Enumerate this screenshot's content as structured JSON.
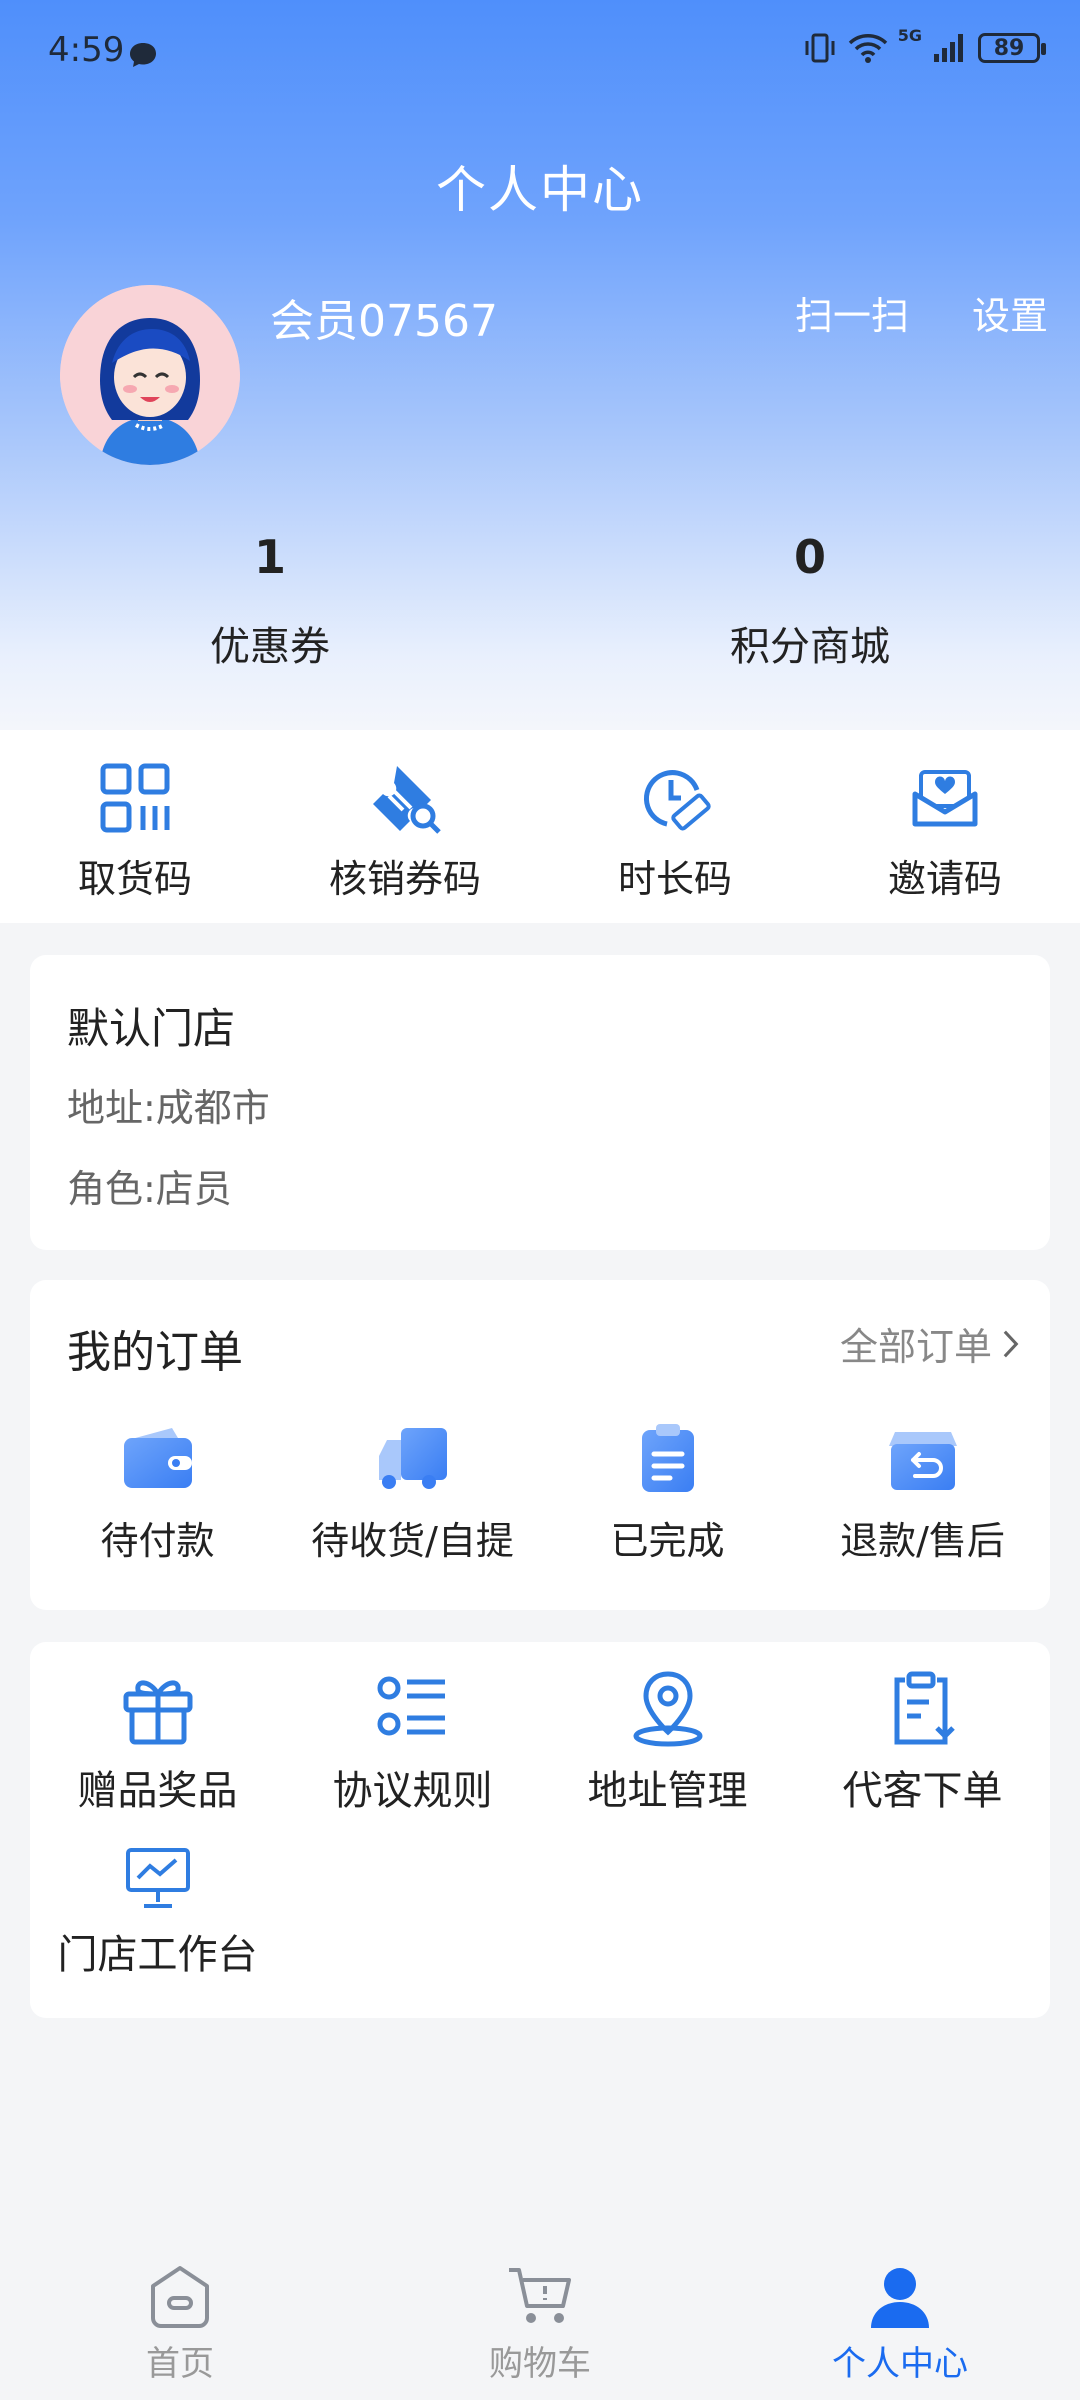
{
  "status_bar": {
    "time": "4:59",
    "network": "5G",
    "battery": "89"
  },
  "header": {
    "title": "个人中心",
    "username": "会员07567",
    "scan_label": "扫一扫",
    "settings_label": "设置"
  },
  "stats": {
    "coupon_count": "1",
    "coupon_label": "优惠券",
    "points_count": "0",
    "points_label": "积分商城"
  },
  "tools": [
    {
      "label": "取货码",
      "icon": "qr-grid-icon"
    },
    {
      "label": "核销券码",
      "icon": "ticket-search-icon"
    },
    {
      "label": "时长码",
      "icon": "clock-ruler-icon"
    },
    {
      "label": "邀请码",
      "icon": "invite-envelope-icon"
    }
  ],
  "store": {
    "title": "默认门店",
    "address": "地址:成都市",
    "role": "角色:店员"
  },
  "orders": {
    "title": "我的订单",
    "all_label": "全部订单",
    "items": [
      {
        "label": "待付款",
        "icon": "wallet-icon"
      },
      {
        "label": "待收货/自提",
        "icon": "truck-icon"
      },
      {
        "label": "已完成",
        "icon": "clipboard-icon"
      },
      {
        "label": "退款/售后",
        "icon": "return-box-icon"
      }
    ]
  },
  "services": [
    {
      "label": "赠品奖品",
      "icon": "gift-icon"
    },
    {
      "label": "协议规则",
      "icon": "list-icon"
    },
    {
      "label": "地址管理",
      "icon": "location-pin-icon"
    },
    {
      "label": "代客下单",
      "icon": "clipboard-download-icon"
    },
    {
      "label": "门店工作台",
      "icon": "monitor-chart-icon"
    }
  ],
  "bottom_nav": [
    {
      "label": "首页",
      "icon": "home-icon"
    },
    {
      "label": "购物车",
      "icon": "cart-icon"
    },
    {
      "label": "个人中心",
      "icon": "person-icon"
    }
  ],
  "colors": {
    "accent": "#1a6bf0",
    "icon_blue": "#3a86f5",
    "header_top": "#4f8ffb"
  }
}
